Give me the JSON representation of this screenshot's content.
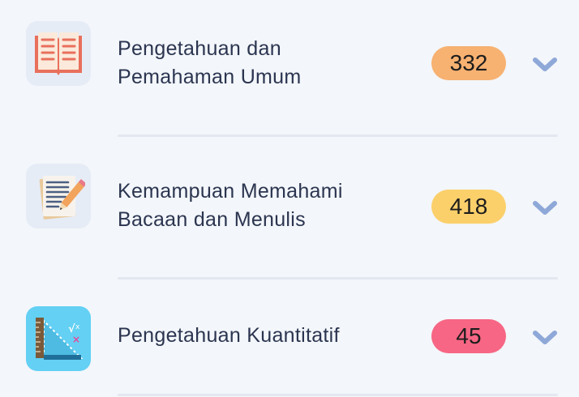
{
  "subjects": [
    {
      "title_line1": "Pengetahuan dan",
      "title_line2": "Pemahaman Umum",
      "count": "332",
      "badge_color": "#f7b171",
      "icon": "open-book-icon"
    },
    {
      "title_line1": "Kemampuan Memahami",
      "title_line2": "Bacaan dan Menulis",
      "count": "418",
      "badge_color": "#fbd06b",
      "icon": "document-pencil-icon"
    },
    {
      "title_line1": "Pengetahuan Kuantitatif",
      "title_line2": "",
      "count": "45",
      "badge_color": "#f76684",
      "icon": "ruler-math-icon"
    }
  ]
}
